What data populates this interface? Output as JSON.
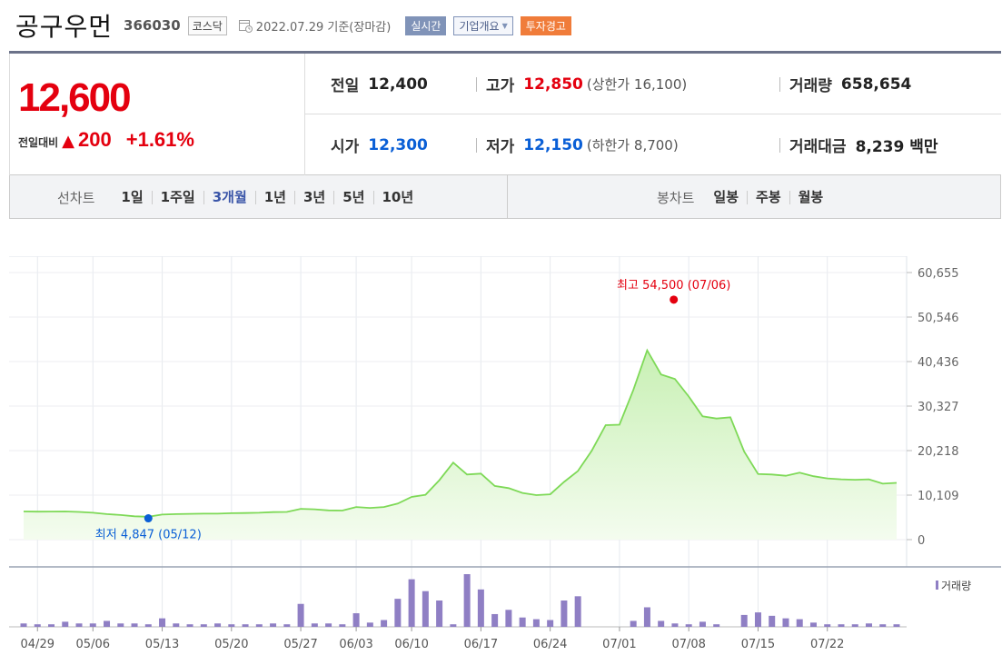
{
  "header": {
    "stock_name": "공구우먼",
    "stock_code": "366030",
    "market_tag": "코스닥",
    "date_text": "2022.07.29  기준(장마감)",
    "realtime_label": "실시간",
    "company_label": "기업개요",
    "warning_label": "투자경고"
  },
  "summary": {
    "current_price": "12,600",
    "change_label": "전일대비",
    "change_icon": "up-triangle-icon",
    "change_value": "200",
    "change_pct": "+1.61%",
    "prev_close_label": "전일",
    "prev_close": "12,400",
    "high_label": "고가",
    "high": "12,850",
    "upper_limit": "(상한가 16,100)",
    "volume_label": "거래량",
    "volume": "658,654",
    "open_label": "시가",
    "open": "12,300",
    "low_label": "저가",
    "low": "12,150",
    "lower_limit": "(하한가 8,700)",
    "amount_label": "거래대금",
    "amount": "8,239 백만"
  },
  "period_bar": {
    "line_chart_label": "선차트",
    "periods": [
      "1일",
      "1주일",
      "3개월",
      "1년",
      "3년",
      "5년",
      "10년"
    ],
    "active_period": "3개월",
    "candle_label": "봉차트",
    "candle_periods": [
      "일봉",
      "주봉",
      "월봉"
    ]
  },
  "colors": {
    "up": "#e4000f",
    "down": "#0a5fd6",
    "line": "#7ed957",
    "fill_top": "#c8f0b4",
    "fill_bottom": "#f4fcef",
    "volume": "#8f7fc4"
  },
  "chart_data": {
    "type": "area",
    "y_ticks": [
      "60,655",
      "50,546",
      "40,436",
      "30,327",
      "20,218",
      "10,109",
      "0"
    ],
    "ylim": [
      0,
      60655
    ],
    "x_tick_labels": [
      "04/29",
      "05/06",
      "05/13",
      "05/20",
      "05/27",
      "06/03",
      "06/10",
      "06/17",
      "06/24",
      "07/01",
      "07/08",
      "07/15",
      "07/22"
    ],
    "dates": [
      "04/28",
      "04/29",
      "05/02",
      "05/03",
      "05/04",
      "05/06",
      "05/09",
      "05/10",
      "05/11",
      "05/12",
      "05/13",
      "05/16",
      "05/17",
      "05/18",
      "05/19",
      "05/20",
      "05/23",
      "05/24",
      "05/25",
      "05/26",
      "05/27",
      "05/30",
      "05/31",
      "06/02",
      "06/03",
      "06/07",
      "06/08",
      "06/09",
      "06/10",
      "06/13",
      "06/14",
      "06/15",
      "06/16",
      "06/17",
      "06/20",
      "06/21",
      "06/22",
      "06/23",
      "06/24",
      "06/27",
      "06/28",
      "06/29",
      "06/30",
      "07/01",
      "07/04",
      "07/05",
      "07/06",
      "07/07",
      "07/08",
      "07/11",
      "07/12",
      "07/13",
      "07/14",
      "07/15",
      "07/18",
      "07/19",
      "07/20",
      "07/21",
      "07/22",
      "07/25",
      "07/26",
      "07/27",
      "07/28",
      "07/29"
    ],
    "close": [
      6400,
      6350,
      6380,
      6400,
      6300,
      6100,
      5800,
      5600,
      5300,
      5200,
      5700,
      5800,
      5850,
      5900,
      5900,
      6000,
      6050,
      6100,
      6250,
      6300,
      7000,
      6900,
      6650,
      6600,
      7400,
      7200,
      7400,
      8200,
      9700,
      10200,
      13500,
      17500,
      14800,
      15000,
      12200,
      11700,
      10600,
      10100,
      10300,
      13100,
      15600,
      20200,
      26000,
      26100,
      34000,
      43000,
      37500,
      36500,
      32500,
      28000,
      27500,
      27800,
      20000,
      14900,
      14800,
      14500,
      15200,
      14400,
      13900,
      13700,
      13600,
      13700,
      12700,
      12900
    ],
    "volume": [
      4,
      3,
      3,
      6,
      4,
      4,
      7,
      4,
      4,
      3,
      10,
      4,
      3,
      3,
      4,
      3,
      3,
      3,
      4,
      3,
      27,
      4,
      4,
      3,
      16,
      5,
      8,
      33,
      56,
      42,
      31,
      3,
      62,
      44,
      15,
      20,
      11,
      9,
      8,
      31,
      36,
      0,
      0,
      0,
      7,
      23,
      7,
      4,
      3,
      6,
      3,
      0,
      14,
      17,
      13,
      10,
      9,
      5,
      3,
      3,
      3,
      4,
      3,
      3
    ],
    "max_marker": {
      "label": "최고 54,500 (07/06)",
      "value": 54500
    },
    "min_marker": {
      "label": "최저 4,847 (05/12)",
      "value": 4847
    },
    "volume_legend": "거래량"
  }
}
